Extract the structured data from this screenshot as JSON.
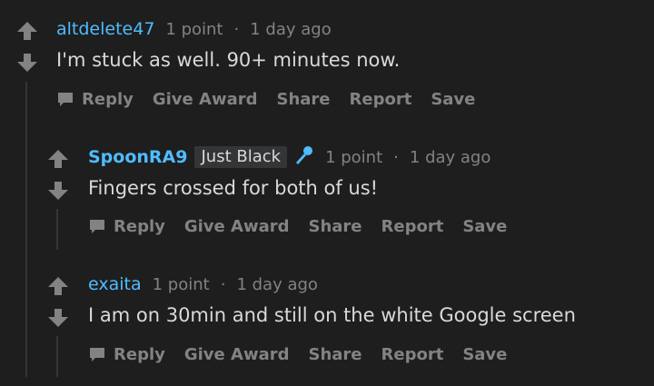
{
  "colors": {
    "background": "#1e1e1e",
    "text": "#d7dadc",
    "muted": "#818384",
    "username": "#4fbcff",
    "flair_bg": "#343536",
    "thread_line": "#343536"
  },
  "actions": {
    "reply": "Reply",
    "give_award": "Give Award",
    "share": "Share",
    "report": "Report",
    "save": "Save"
  },
  "comments": [
    {
      "author": "altdelete47",
      "points": "1 point",
      "separator": "·",
      "time": "1 day ago",
      "body": "I'm stuck as well. 90+ minutes now."
    },
    {
      "author": "SpoonRA9",
      "flair": "Just Black",
      "flair_icon": "microphone-icon",
      "points": "1 point",
      "separator": "·",
      "time": "1 day ago",
      "body": "Fingers crossed for both of us!"
    },
    {
      "author": "exaita",
      "points": "1 point",
      "separator": "·",
      "time": "1 day ago",
      "body": "I am on 30min and still on the white Google screen"
    }
  ]
}
